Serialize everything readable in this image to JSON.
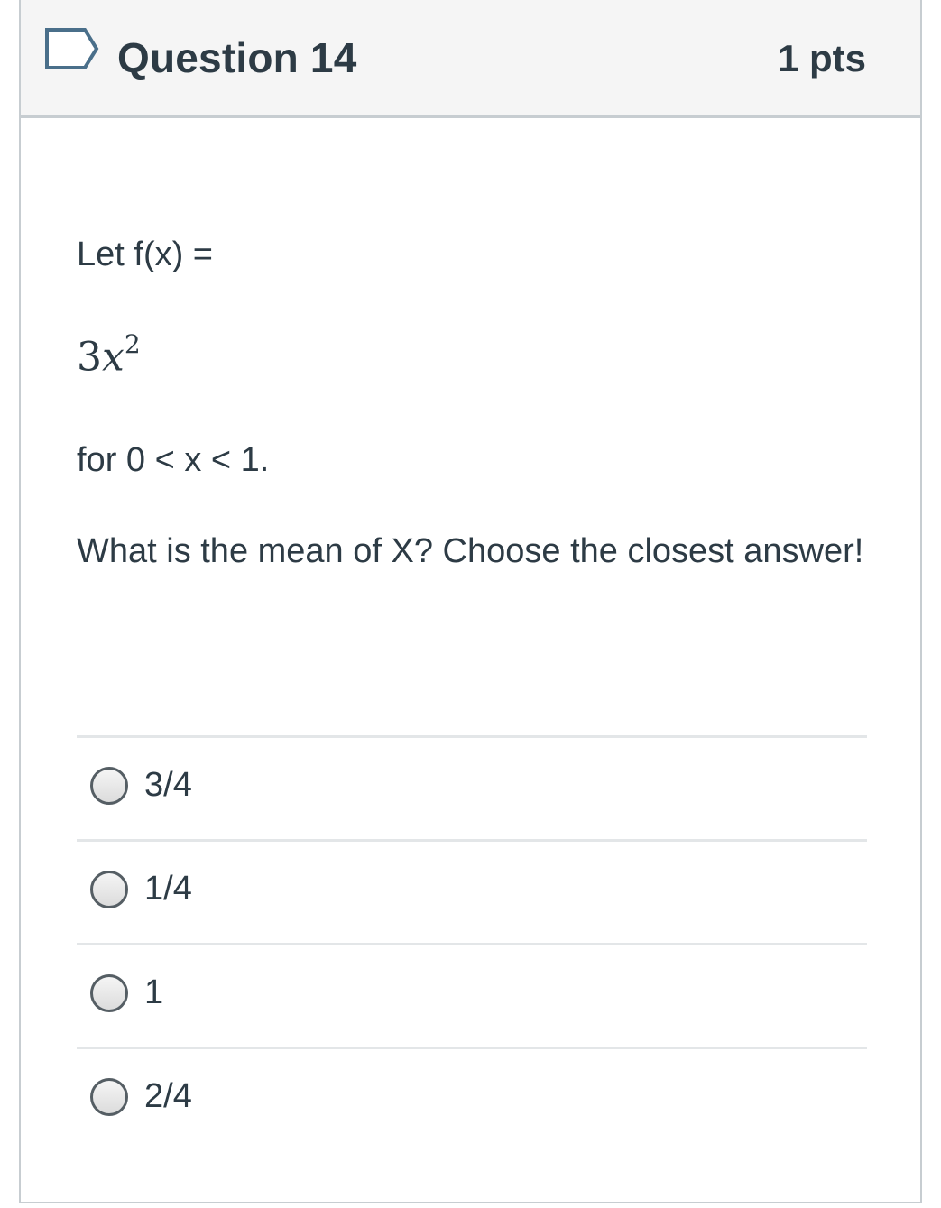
{
  "question": {
    "title": "Question 14",
    "points": "1 pts",
    "flag_icon": "bookmark-flag-icon"
  },
  "body": {
    "line1": "Let f(x) =",
    "math_coef": "3",
    "math_var": "x",
    "math_exp": "2",
    "line2": "for 0 < x < 1.",
    "prompt": "What is the mean of X? Choose the closest answer!"
  },
  "answers": [
    {
      "label": "3/4",
      "selected": false
    },
    {
      "label": "1/4",
      "selected": false
    },
    {
      "label": "1",
      "selected": false
    },
    {
      "label": "2/4",
      "selected": false
    }
  ],
  "colors": {
    "text": "#2d3b45",
    "header_bg": "#f5f5f5",
    "border": "#c7cdd1",
    "flag": "#4a6f8a"
  }
}
